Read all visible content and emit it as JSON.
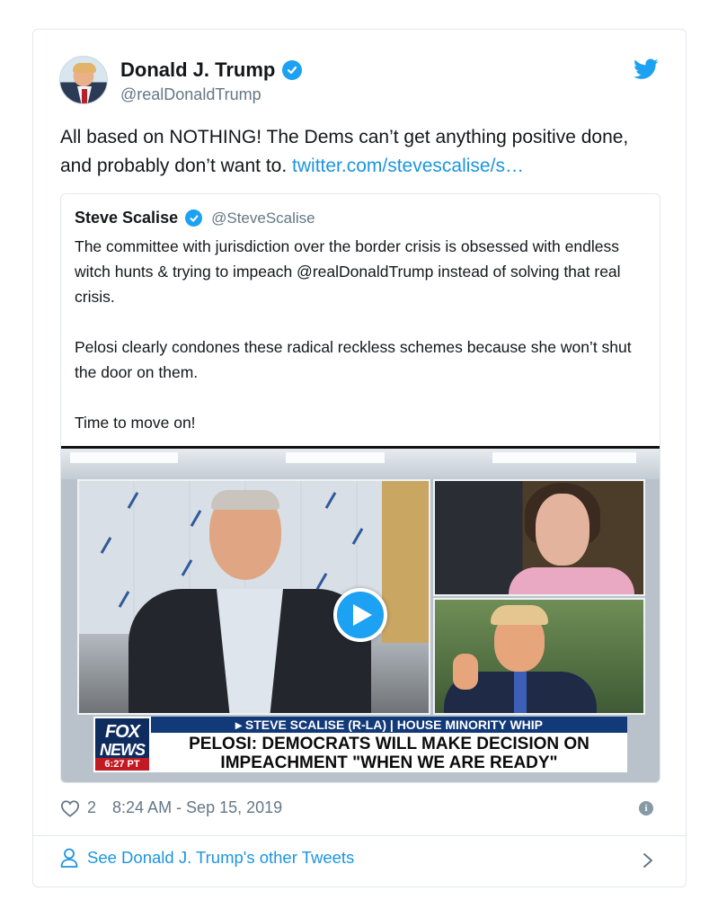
{
  "tweet": {
    "display_name": "Donald J. Trump",
    "handle": "@realDonaldTrump",
    "text": "All based on NOTHING! The Dems can’t get anything positive done, and probably don’t want to.",
    "link_text": "twitter.com/stevescalise/s…",
    "likes": "2",
    "timestamp": "8:24 AM - Sep 15, 2019"
  },
  "quote": {
    "display_name": "Steve Scalise",
    "handle": "@SteveScalise",
    "paragraphs": [
      "The committee with jurisdiction over the border crisis is obsessed with endless witch hunts & trying to impeach @realDonaldTrump instead of solving that real crisis.",
      "Pelosi clearly condones these radical reckless schemes because she won’t shut the door on them.",
      "Time to move on!"
    ],
    "media": {
      "network_line1": "FOX",
      "network_line2": "NEWS",
      "network_time": "6:27 PT",
      "lower_third_strip": "▸ STEVE SCALISE (R-LA) | HOUSE MINORITY WHIP",
      "headline_line1": "PELOSI: DEMOCRATS WILL MAKE DECISION ON",
      "headline_line2": "IMPEACHMENT \"WHEN WE ARE READY\""
    }
  },
  "footer": {
    "other_tweets_label": "See Donald J. Trump's other Tweets"
  },
  "icons": {
    "verified": "verified-badge-icon",
    "brand": "twitter-bird-icon",
    "play": "play-icon",
    "like": "heart-icon",
    "info": "info-icon",
    "profile": "person-icon",
    "chevron": "chevron-right-icon"
  },
  "colors": {
    "accent": "#1da1f2",
    "link": "#1b95e0",
    "secondary_text": "#657786",
    "border": "#e1e8ed"
  }
}
